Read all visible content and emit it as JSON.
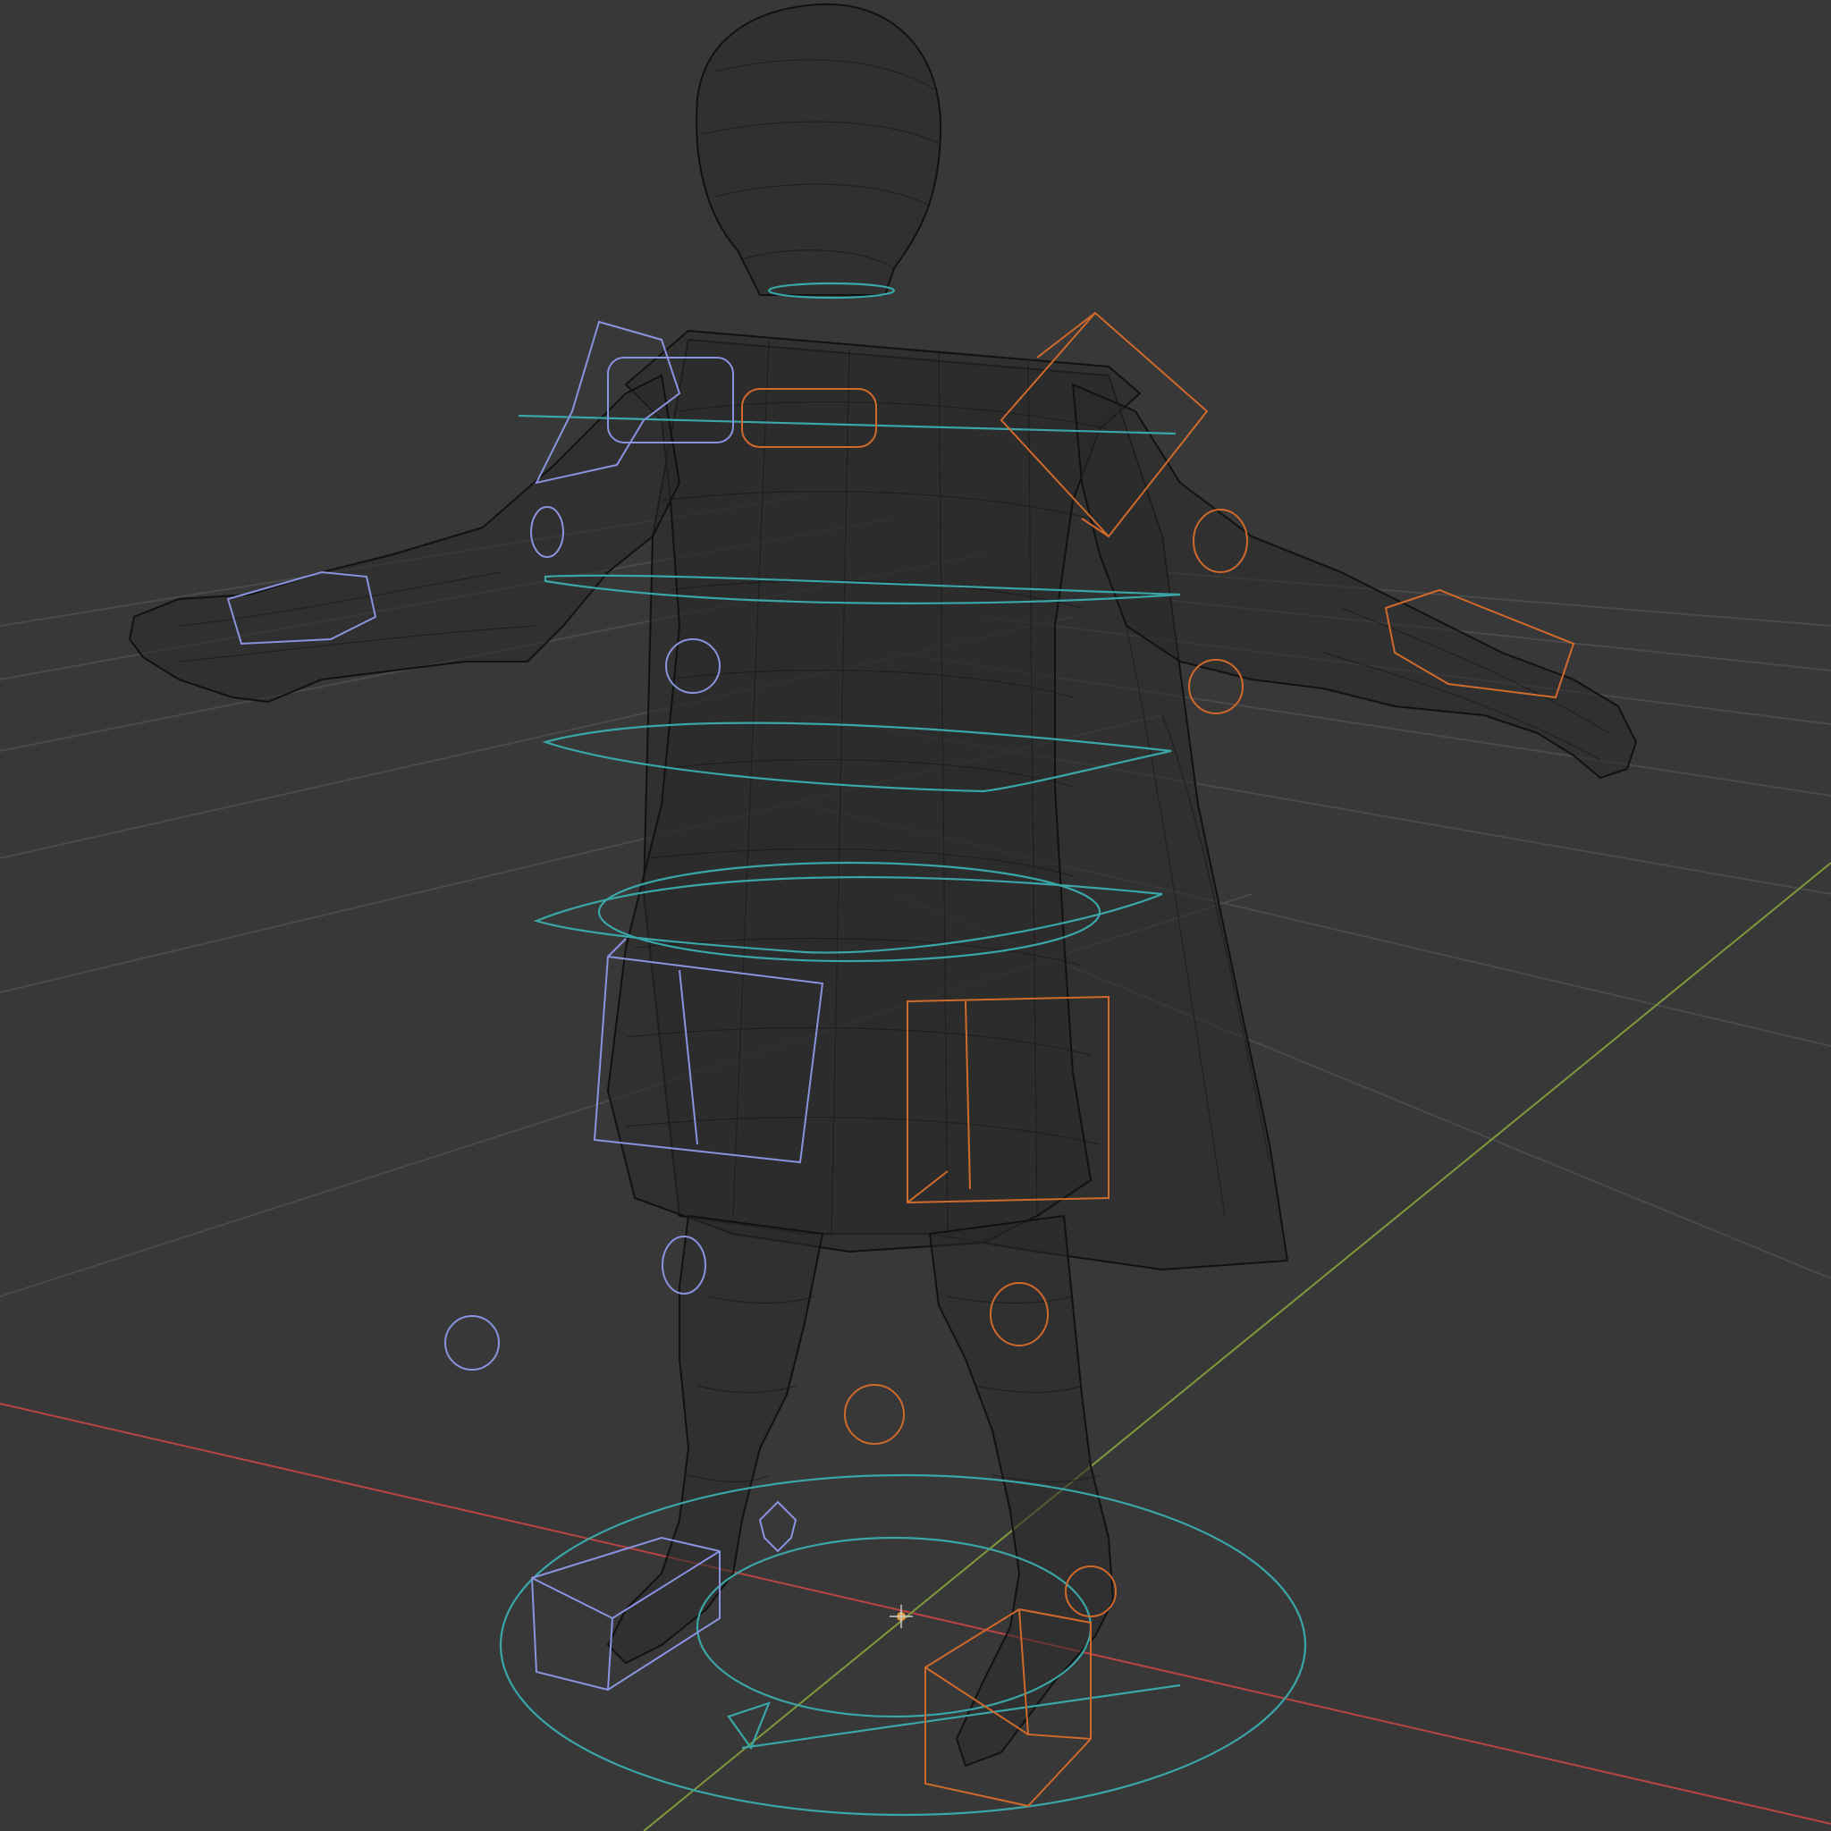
{
  "viewport": {
    "mode": "wireframe",
    "subject": "rigged-character",
    "background": "#383838",
    "grid_color": "#4a4a4a"
  },
  "colors": {
    "x_axis": "#b84444",
    "y_axis": "#7f9a3a",
    "mesh_wire": "#141414",
    "controls_center": "#3aa6a8",
    "controls_left": "#8a93e0",
    "controls_right": "#d06a2c",
    "origin": "#e0a040"
  },
  "icons": {
    "origin": "origin-cursor-icon"
  }
}
